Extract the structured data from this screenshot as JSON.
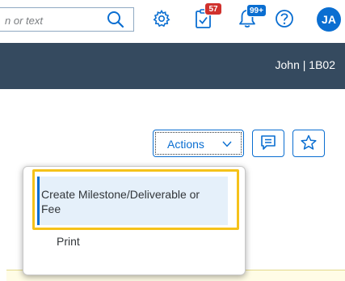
{
  "shellbar": {
    "search_placeholder": "n or text",
    "tasks_badge": "57",
    "notifications_badge": "99+",
    "avatar_initials": "JA"
  },
  "header": {
    "user_info": "John | 1B02"
  },
  "toolbar": {
    "actions_label": "Actions"
  },
  "menu": {
    "items": [
      {
        "label": "Create Milestone/Deliverable or Fee",
        "selected": true
      },
      {
        "label": "Print",
        "selected": false
      }
    ]
  },
  "colors": {
    "brand": "#0a6ed1",
    "header": "#354a5f",
    "badge_red": "#d0312d",
    "highlight": "#f5c21a",
    "selected_item_bg": "#e5f0fa"
  }
}
